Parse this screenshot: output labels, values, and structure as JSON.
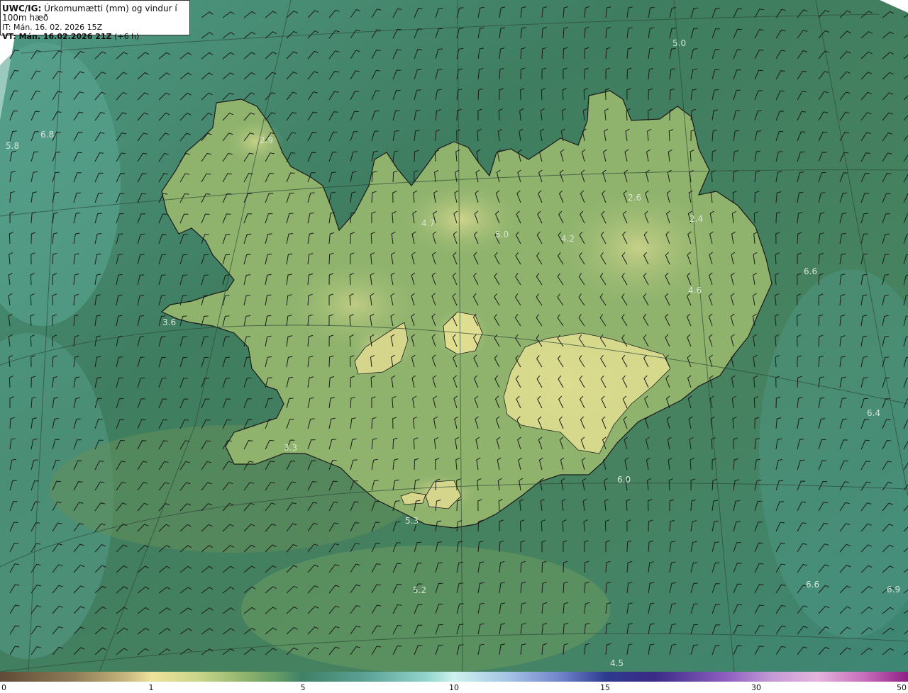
{
  "header": {
    "line1_bold": "UWC/IG:",
    "line1_rest": " Úrkomumætti (mm) og vindur í 100m hæð",
    "line2": "IT: Mán. 16. 02. 2026 15Z",
    "line3_bold": "VT: Mán. 16.02.2026 21Z",
    "line3_rest": " (+6 h)"
  },
  "map_labels": {
    "l0": "5.0",
    "l1": "6.8",
    "l2": "5.8",
    "l3": "2.9",
    "l4": "2.6",
    "l5": "2.4",
    "l6": "4.7",
    "l7": "5.0",
    "l8": "4.2",
    "l9": "6.6",
    "l10": "4.6",
    "l11": "3.6",
    "l12": "6.4",
    "l13": "3.3",
    "l14": "6.0",
    "l15": "5.3",
    "l16": "5.2",
    "l17": "6.6",
    "l18": "6.9",
    "l19": "4.5"
  },
  "colorbar": {
    "t0": "0",
    "t1": "1",
    "t2": "5",
    "t3": "10",
    "t4": "15",
    "t5": "30",
    "t6": "50"
  },
  "colors": {
    "sea": "#3f7e63",
    "land": "#8fb36d",
    "highland": "#d8d98d",
    "coastline": "#1a1a1a",
    "label": "#d9e4d6"
  }
}
